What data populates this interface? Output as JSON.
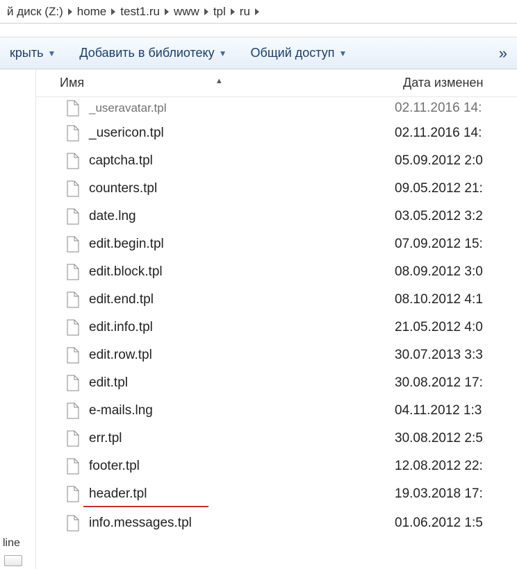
{
  "breadcrumb": {
    "items": [
      "й диск (Z:)",
      "home",
      "test1.ru",
      "www",
      "tpl",
      "ru"
    ]
  },
  "toolbar": {
    "open_label": "крыть",
    "library_label": "Добавить в библиотеку",
    "share_label": "Общий доступ",
    "overflow_label": "»"
  },
  "columns": {
    "name": "Имя",
    "date": "Дата изменен"
  },
  "sidebar": {
    "label": "line"
  },
  "files": [
    {
      "name": "_useravatar.tpl",
      "date": "02.11.2016 14:"
    },
    {
      "name": "_usericon.tpl",
      "date": "02.11.2016 14:"
    },
    {
      "name": "captcha.tpl",
      "date": "05.09.2012 2:0"
    },
    {
      "name": "counters.tpl",
      "date": "09.05.2012 21:"
    },
    {
      "name": "date.lng",
      "date": "03.05.2012 3:2"
    },
    {
      "name": "edit.begin.tpl",
      "date": "07.09.2012 15:"
    },
    {
      "name": "edit.block.tpl",
      "date": "08.09.2012 3:0"
    },
    {
      "name": "edit.end.tpl",
      "date": "08.10.2012 4:1"
    },
    {
      "name": "edit.info.tpl",
      "date": "21.05.2012 4:0"
    },
    {
      "name": "edit.row.tpl",
      "date": "30.07.2013 3:3"
    },
    {
      "name": "edit.tpl",
      "date": "30.08.2012 17:"
    },
    {
      "name": "e-mails.lng",
      "date": "04.11.2012 1:3"
    },
    {
      "name": "err.tpl",
      "date": "30.08.2012 2:5"
    },
    {
      "name": "footer.tpl",
      "date": "12.08.2012 22:"
    },
    {
      "name": "header.tpl",
      "date": "19.03.2018 17:",
      "highlight": true
    },
    {
      "name": "info.messages.tpl",
      "date": "01.06.2012 1:5"
    }
  ]
}
